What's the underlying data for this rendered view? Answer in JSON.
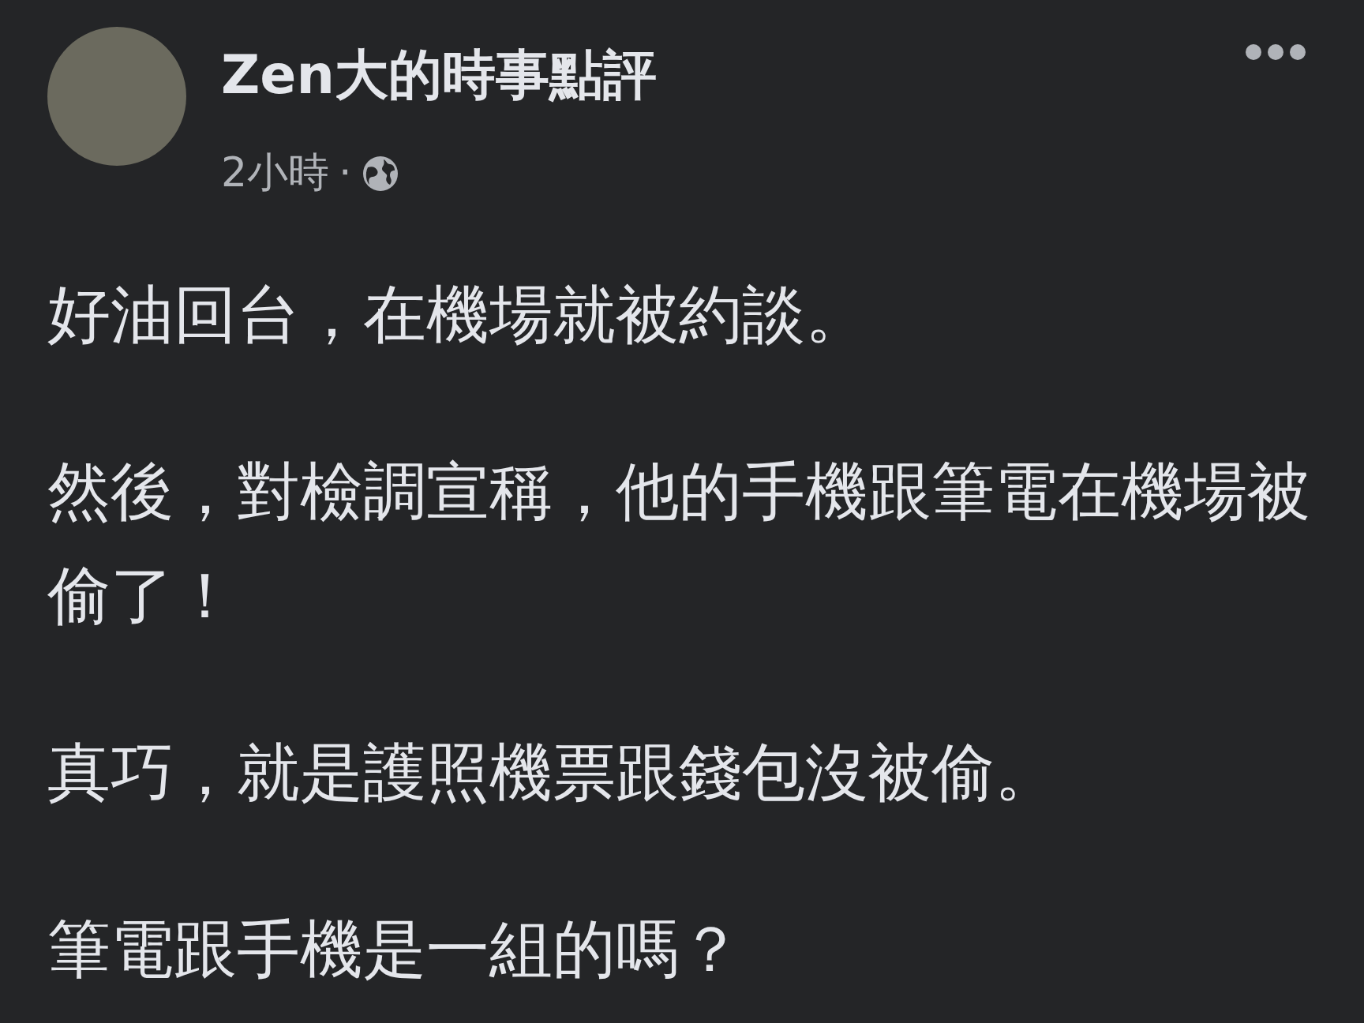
{
  "post": {
    "author": "Zen大的時事點評",
    "time": "2小時",
    "separator": "·",
    "paragraphs": [
      "好油回台，在機場就被約談。",
      "然後，對檢調宣稱，他的手機跟筆電在機場被偷了！",
      "真巧，就是護照機票跟錢包沒被偷。",
      "筆電跟手機是一組的嗎？"
    ]
  }
}
